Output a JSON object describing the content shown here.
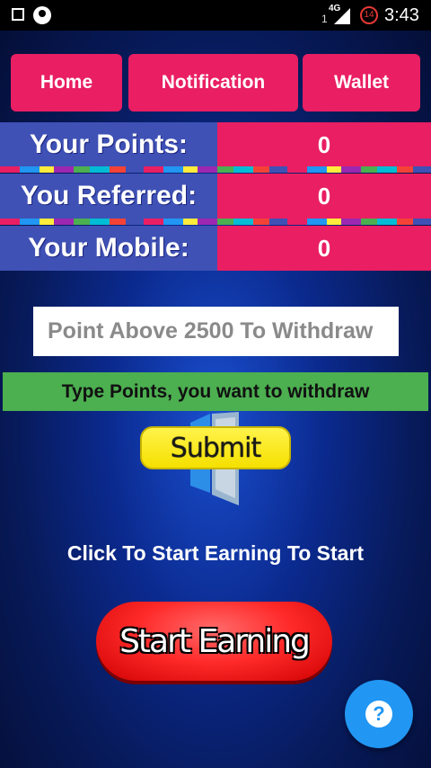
{
  "status_bar": {
    "icons": [
      "square-icon",
      "face-icon",
      "signal-icon",
      "notification-icon"
    ],
    "sim": "1",
    "network": "4G",
    "battery_badge": "14",
    "time": "3:43"
  },
  "nav": {
    "home": "Home",
    "notification": "Notification",
    "wallet": "Wallet"
  },
  "stats": {
    "points_label": "Your Points:",
    "points_value": "0",
    "referred_label": "You Referred:",
    "referred_value": "0",
    "mobile_label": "Your Mobile:",
    "mobile_value": "0"
  },
  "withdraw": {
    "placeholder": "Point Above 2500 To Withdraw",
    "hint": "Type Points, you want to withdraw",
    "submit_label": "Submit"
  },
  "earning": {
    "text": "Click To Start Earning To Start",
    "button_label": "Start Earning"
  },
  "fab": {
    "icon": "help-icon",
    "symbol": "?"
  },
  "colors": {
    "accent_pink": "#e91e63",
    "label_blue": "#3f51b5",
    "hint_green": "#4caf50",
    "submit_yellow": "#fff34a",
    "start_red": "#ff2b2b",
    "fab_blue": "#2196f3"
  }
}
